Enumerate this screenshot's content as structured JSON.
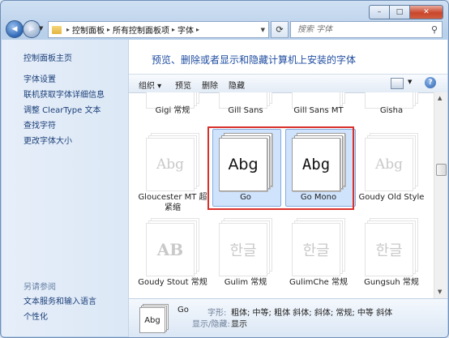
{
  "window": {
    "minimize": "–",
    "maximize": "□",
    "close": "✕"
  },
  "nav": {
    "back": "◀",
    "forward": "▶"
  },
  "address": {
    "crumbs": [
      "控制面板",
      "所有控制面板项",
      "字体"
    ]
  },
  "search": {
    "placeholder": "搜索 字体"
  },
  "sidebar": {
    "home": "控制面板主页",
    "links": [
      "字体设置",
      "联机获取字体详细信息",
      "调整 ClearType 文本",
      "查找字符",
      "更改字体大小"
    ],
    "see_also": "另请参阅",
    "see_also_links": [
      "文本服务和输入语言",
      "个性化"
    ]
  },
  "main": {
    "heading": "预览、删除或者显示和隐藏计算机上安装的字体"
  },
  "toolbar": {
    "organize": "组织 ▾",
    "preview": "预览",
    "delete": "删除",
    "hide": "隐藏",
    "help": "?"
  },
  "fonts": [
    {
      "name": "Gigi 常规",
      "sample": ""
    },
    {
      "name": "Gill Sans",
      "sample": ""
    },
    {
      "name": "Gill Sans MT",
      "sample": ""
    },
    {
      "name": "Gisha",
      "sample": ""
    },
    {
      "name": "Gloucester MT 超紧缩",
      "sample": "Abg"
    },
    {
      "name": "Go",
      "sample": "Abg"
    },
    {
      "name": "Go Mono",
      "sample": "Abg"
    },
    {
      "name": "Goudy Old Style",
      "sample": "Abg"
    },
    {
      "name": "Goudy Stout 常规",
      "sample": "AB"
    },
    {
      "name": "Gulim 常规",
      "sample": "한글"
    },
    {
      "name": "GulimChe 常规",
      "sample": "한글"
    },
    {
      "name": "Gungsuh 常规",
      "sample": "한글"
    }
  ],
  "details": {
    "name": "Go",
    "thumb_sample": "Abg",
    "style_label": "字形:",
    "style_value": "粗体; 中等; 粗体 斜体; 斜体; 常规; 中等 斜体",
    "visibility_label": "显示/隐藏:",
    "visibility_value": "显示"
  },
  "colors": {
    "accent_heading": "#1f4da0",
    "selection": "#cfe3fc",
    "highlight_box": "#d9302c"
  }
}
